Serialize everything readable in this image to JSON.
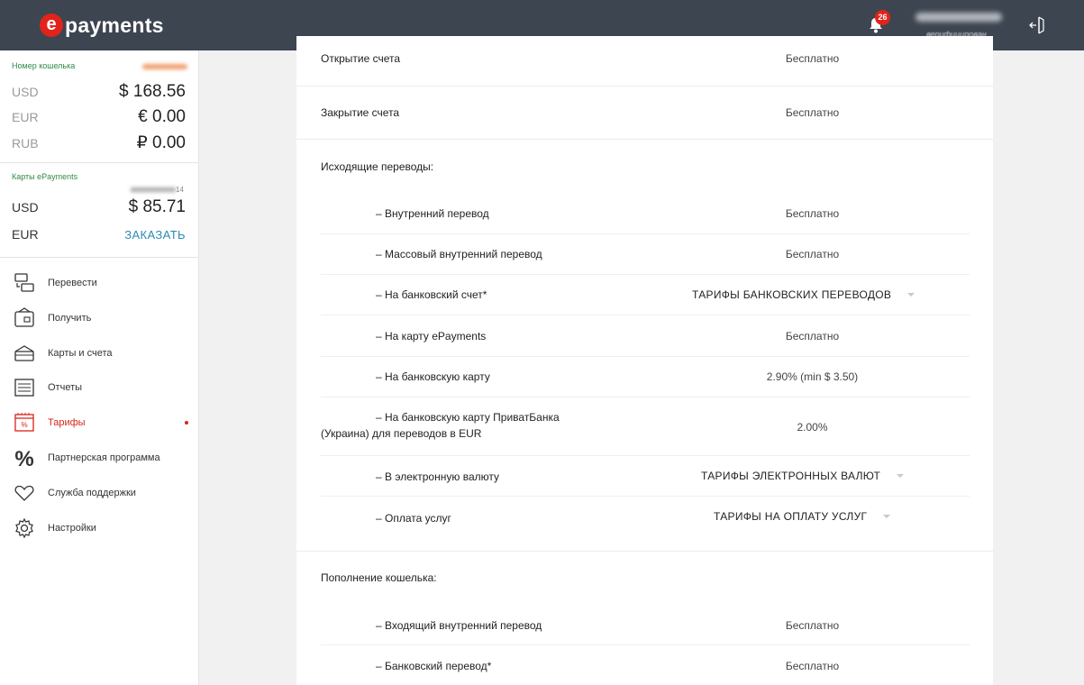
{
  "header": {
    "logo_mark": "e",
    "logo_text": "payments",
    "notifications_count": "26",
    "user_status": "верифицирован"
  },
  "sidebar": {
    "wallet_heading": "Номер кошелька",
    "balances": [
      {
        "currency": "USD",
        "amount": "$ 168.56"
      },
      {
        "currency": "EUR",
        "amount": "€ 0.00"
      },
      {
        "currency": "RUB",
        "amount": "₽ 0.00"
      }
    ],
    "cards_heading": "Карты ePayments",
    "card_number_suffix": "14",
    "cards": [
      {
        "currency": "USD",
        "amount": "$ 85.71"
      },
      {
        "currency": "EUR",
        "action": "ЗАКАЗАТЬ"
      }
    ],
    "menu": [
      {
        "label": "Перевести",
        "icon": "transfer-icon"
      },
      {
        "label": "Получить",
        "icon": "wallet-icon"
      },
      {
        "label": "Карты и счета",
        "icon": "cards-icon"
      },
      {
        "label": "Отчеты",
        "icon": "reports-icon"
      },
      {
        "label": "Тарифы",
        "icon": "tariffs-icon",
        "active": true
      },
      {
        "label": "Партнерская программа",
        "icon": "percent-icon"
      },
      {
        "label": "Служба поддержки",
        "icon": "heart-icon"
      },
      {
        "label": "Настройки",
        "icon": "gear-icon"
      }
    ]
  },
  "tariffs": {
    "open_account": {
      "label": "Открытие счета",
      "value": "Бесплатно"
    },
    "close_account": {
      "label": "Закрытие счета",
      "value": "Бесплатно"
    },
    "outgoing_heading": "Исходящие переводы:",
    "outgoing": [
      {
        "label": "– Внутренний перевод",
        "value": "Бесплатно"
      },
      {
        "label": "– Массовый внутренний перевод",
        "value": "Бесплатно"
      },
      {
        "label": "– На банковский счет*",
        "value": "ТАРИФЫ БАНКОВСКИХ ПЕРЕВОДОВ"
      },
      {
        "label": "– На карту ePayments",
        "value": "Бесплатно"
      },
      {
        "label": "– На банковскую карту",
        "value": "2.90% (min $ 3.50)"
      },
      {
        "label_line1": "– На банковскую карту ПриватБанка",
        "label_line2": "(Украина) для переводов в EUR",
        "value": "2.00%"
      },
      {
        "label": "– В электронную валюту",
        "value": "ТАРИФЫ ЭЛЕКТРОННЫХ ВАЛЮТ"
      },
      {
        "label": "– Оплата услуг",
        "value": "ТАРИФЫ НА ОПЛАТУ УСЛУГ"
      }
    ],
    "topup_heading": "Пополнение кошелька:",
    "topup": [
      {
        "label": "– Входящий внутренний перевод",
        "value": "Бесплатно"
      },
      {
        "label": "– Банковский перевод*",
        "value": "Бесплатно"
      }
    ]
  },
  "colors": {
    "header_bg": "#3d4551",
    "brand_red": "#e2231a",
    "wallet_green": "#2f8a46",
    "link_blue": "#2a8bb4"
  }
}
